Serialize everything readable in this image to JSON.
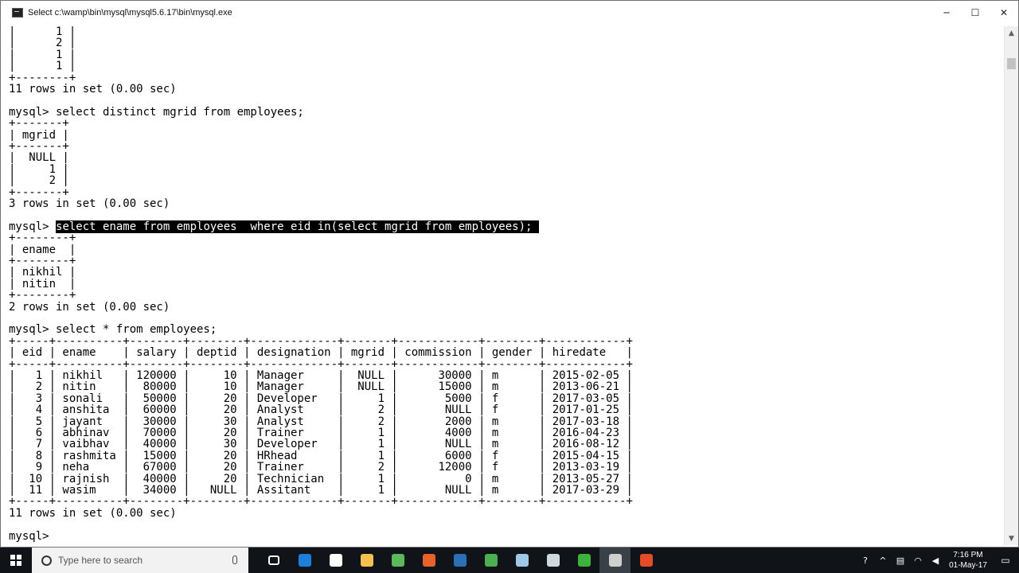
{
  "window": {
    "title": "Select c:\\wamp\\bin\\mysql\\mysql5.6.17\\bin\\mysql.exe",
    "minimize_glyph": "─",
    "maximize_glyph": "☐",
    "close_glyph": "✕"
  },
  "console": {
    "lines": [
      "|      1 |",
      "|      2 |",
      "|      1 |",
      "|      1 |",
      "+--------+",
      "11 rows in set (0.00 sec)",
      "",
      "mysql> select distinct mgrid from employees;",
      "+-------+",
      "| mgrid |",
      "+-------+",
      "|  NULL |",
      "|     1 |",
      "|     2 |",
      "+-------+",
      "3 rows in set (0.00 sec)",
      "",
      "",
      "+--------+",
      "| ename  |",
      "+--------+",
      "| nikhil |",
      "| nitin  |",
      "+--------+",
      "2 rows in set (0.00 sec)",
      "",
      "mysql> select * from employees;",
      "+-----+----------+--------+--------+-------------+-------+------------+--------+------------+",
      "| eid | ename    | salary | deptid | designation | mgrid | commission | gender | hiredate   |",
      "+-----+----------+--------+--------+-------------+-------+------------+--------+------------+",
      "|   1 | nikhil   | 120000 |     10 | Manager     |  NULL |      30000 | m      | 2015-02-05 |",
      "|   2 | nitin    |  80000 |     10 | Manager     |  NULL |      15000 | m      | 2013-06-21 |",
      "|   3 | sonali   |  50000 |     20 | Developer   |     1 |       5000 | f      | 2017-03-05 |",
      "|   4 | anshita  |  60000 |     20 | Analyst     |     2 |       NULL | f      | 2017-01-25 |",
      "|   5 | jayant   |  30000 |     30 | Analyst     |     2 |       2000 | m      | 2017-03-18 |",
      "|   6 | abhinav  |  70000 |     20 | Trainer     |     1 |       4000 | m      | 2016-04-23 |",
      "|   7 | vaibhav  |  40000 |     30 | Developer   |     1 |       NULL | m      | 2016-08-12 |",
      "|   8 | rashmita |  15000 |     20 | HRhead      |     1 |       6000 | f      | 2015-04-15 |",
      "|   9 | neha     |  67000 |     20 | Trainer     |     2 |      12000 | f      | 2013-03-19 |",
      "|  10 | rajnish  |  40000 |     20 | Technician  |     1 |          0 | m      | 2013-05-27 |",
      "|  11 | wasim    |  34000 |   NULL | Assitant    |     1 |       NULL | m      | 2017-03-29 |",
      "+-----+----------+--------+--------+-------------+-------+------------+--------+------------+",
      "11 rows in set (0.00 sec)",
      "",
      "mysql> "
    ],
    "highlighted_line": {
      "prompt": "mysql> ",
      "selected_text": "select ename from employees  where eid in(select mgrid from employees); "
    }
  },
  "taskbar": {
    "search_placeholder": "Type here to search",
    "apps": [
      {
        "name": "task-view",
        "color": "#ffffff"
      },
      {
        "name": "edge",
        "color": "#1e7fd8"
      },
      {
        "name": "store",
        "color": "#ffffff"
      },
      {
        "name": "file-explorer",
        "color": "#f2c14e"
      },
      {
        "name": "app-green",
        "color": "#5cb85c"
      },
      {
        "name": "app-orange",
        "color": "#e8632b"
      },
      {
        "name": "app-blue",
        "color": "#2b6fb6"
      },
      {
        "name": "chrome",
        "color": "#4caf50"
      },
      {
        "name": "notepad",
        "color": "#9ec7e8"
      },
      {
        "name": "settings-app",
        "color": "#cfd8dc"
      },
      {
        "name": "camtasia",
        "color": "#3db33d"
      },
      {
        "name": "console",
        "color": "#d0d0d0"
      },
      {
        "name": "app-red",
        "color": "#e34c26"
      }
    ],
    "clock_time": "7:16 PM",
    "clock_date": "01-May-17"
  }
}
